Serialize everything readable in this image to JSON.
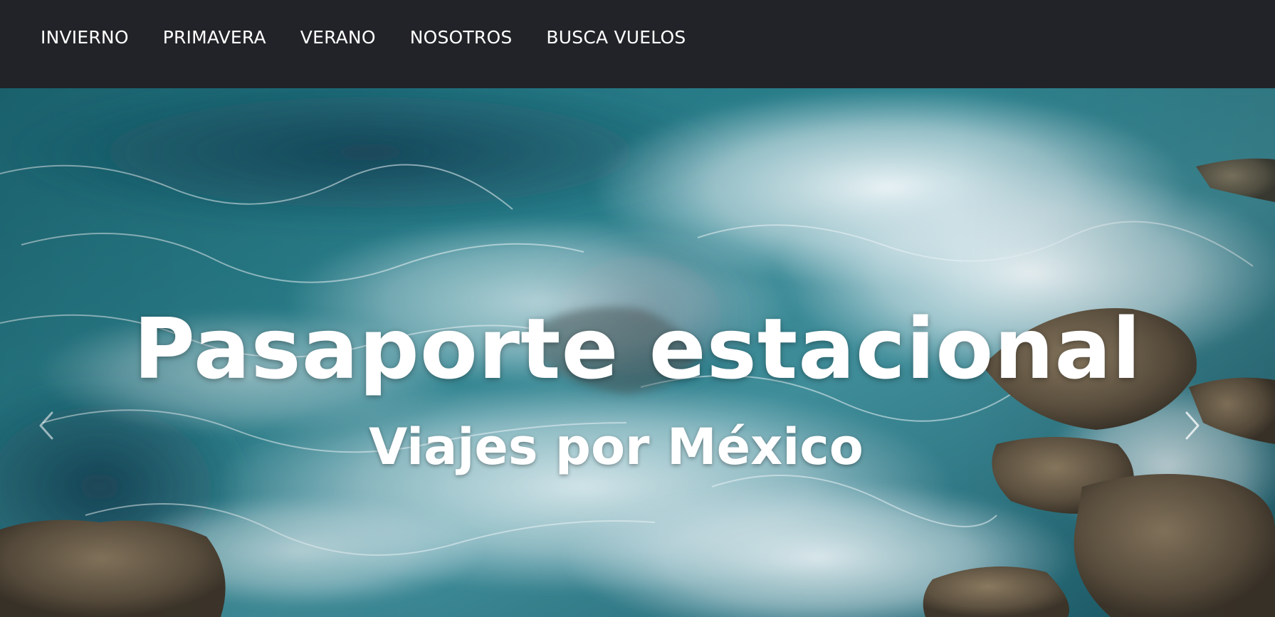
{
  "nav": {
    "items": [
      {
        "label": "INVIERNO"
      },
      {
        "label": "PRIMAVERA"
      },
      {
        "label": "VERANO"
      },
      {
        "label": "NOSOTROS"
      },
      {
        "label": "BUSCA VUELOS"
      }
    ]
  },
  "hero": {
    "title": "Pasaporte estacional",
    "subtitle": "Viajes por México",
    "background": "ocean waves crashing on rocks",
    "prev_icon": "chevron-left-icon",
    "next_icon": "chevron-right-icon"
  },
  "colors": {
    "navbar_bg": "#212328",
    "nav_text": "#ffffff",
    "hero_text": "#ffffff",
    "water_deep": "#1f5f6e",
    "water_mid": "#2f8490",
    "foam": "#e8f1f4",
    "rock": "#6e5f4a"
  }
}
